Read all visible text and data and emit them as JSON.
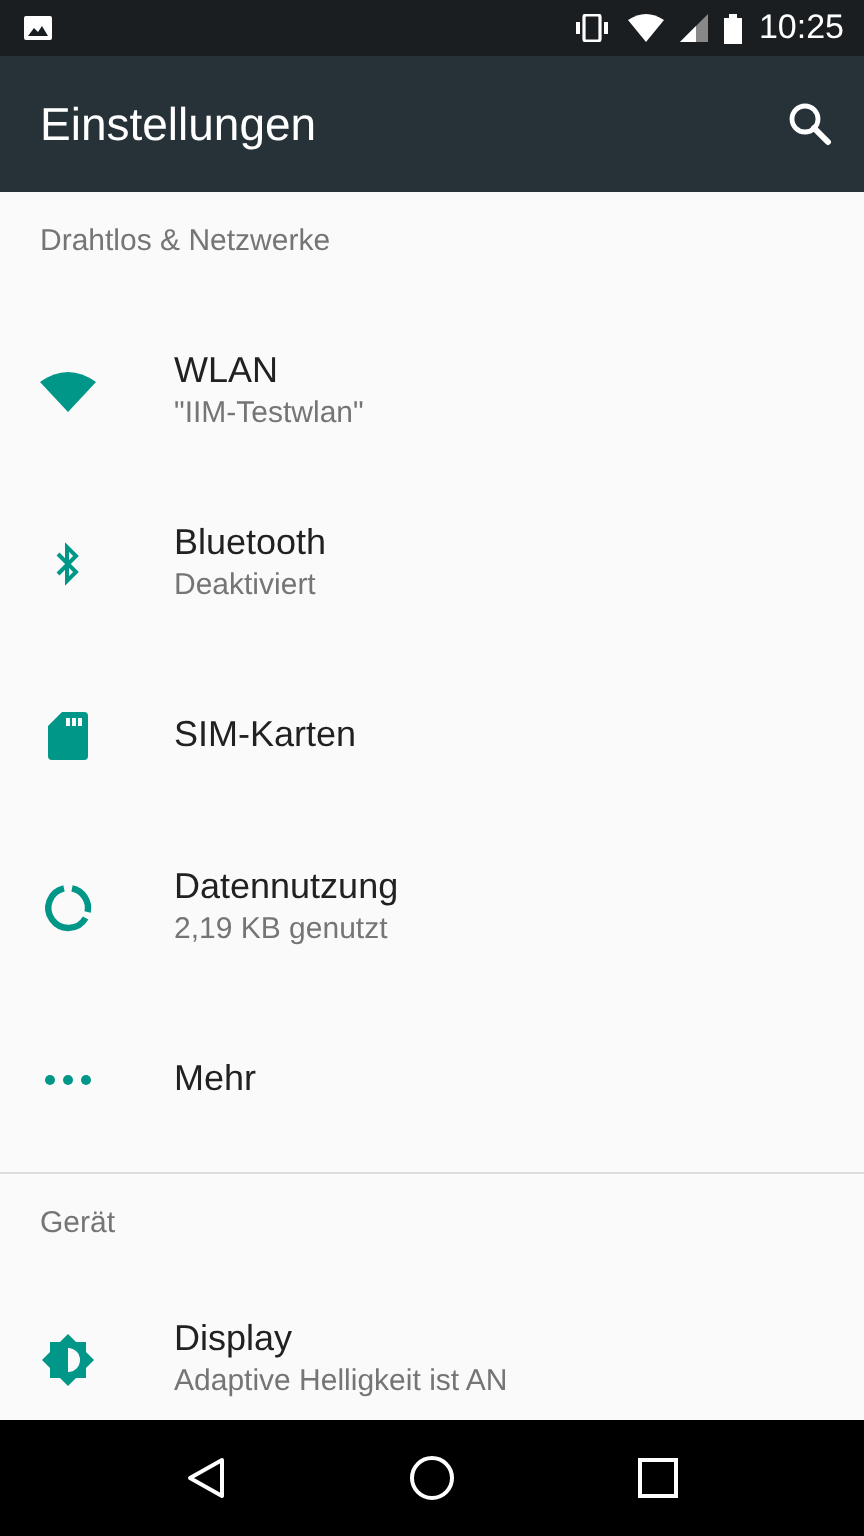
{
  "status_bar": {
    "time": "10:25"
  },
  "toolbar": {
    "title": "Einstellungen"
  },
  "sections": [
    {
      "header": "Drahtlos & Netzwerke",
      "items": [
        {
          "title": "WLAN",
          "subtitle": "\"IIM-Testwlan\""
        },
        {
          "title": "Bluetooth",
          "subtitle": "Deaktiviert"
        },
        {
          "title": "SIM-Karten"
        },
        {
          "title": "Datennutzung",
          "subtitle": "2,19 KB genutzt"
        },
        {
          "title": "Mehr"
        }
      ]
    },
    {
      "header": "Gerät",
      "items": [
        {
          "title": "Display",
          "subtitle": "Adaptive Helligkeit ist AN"
        }
      ]
    }
  ]
}
